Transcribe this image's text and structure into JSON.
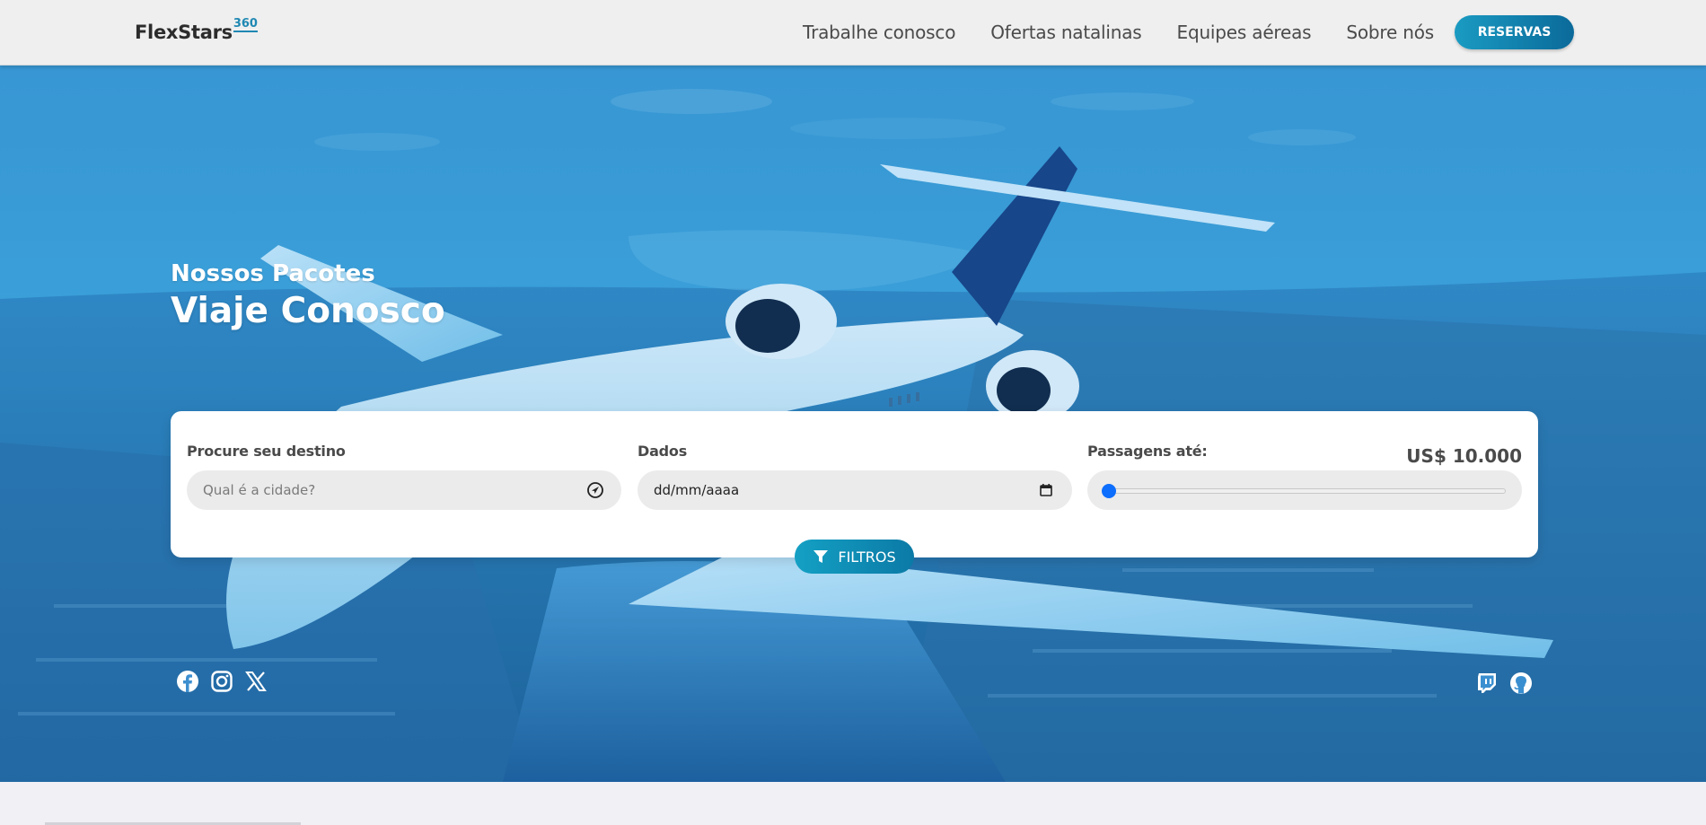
{
  "brand": {
    "name": "FlexStars",
    "superscript": "360"
  },
  "nav": {
    "items": [
      "Trabalhe conosco",
      "Ofertas natalinas",
      "Equipes aéreas",
      "Sobre nós"
    ],
    "cta": "RESERVAS"
  },
  "hero": {
    "subtitle": "Nossos Pacotes",
    "title": "Viaje Conosco"
  },
  "search": {
    "destination": {
      "label": "Procure seu destino",
      "placeholder": "Qual é a cidade?",
      "icon": "navigation-arrow-icon"
    },
    "date": {
      "label": "Dados",
      "value": "dd/mm/aaaa",
      "icon": "calendar-icon"
    },
    "price": {
      "label": "Passagens até:",
      "value": "US$ 10.000",
      "slider_fraction": 0.0
    },
    "filter_button": "FILTROS"
  },
  "social": {
    "left": [
      "facebook-icon",
      "instagram-icon",
      "x-icon"
    ],
    "right": [
      "twitch-icon",
      "github-icon"
    ]
  },
  "colors": {
    "accent": "#1a9bc2",
    "accent_dark": "#0b6a9a",
    "slider_thumb": "#0d6efd",
    "header_bg": "#efefef"
  }
}
